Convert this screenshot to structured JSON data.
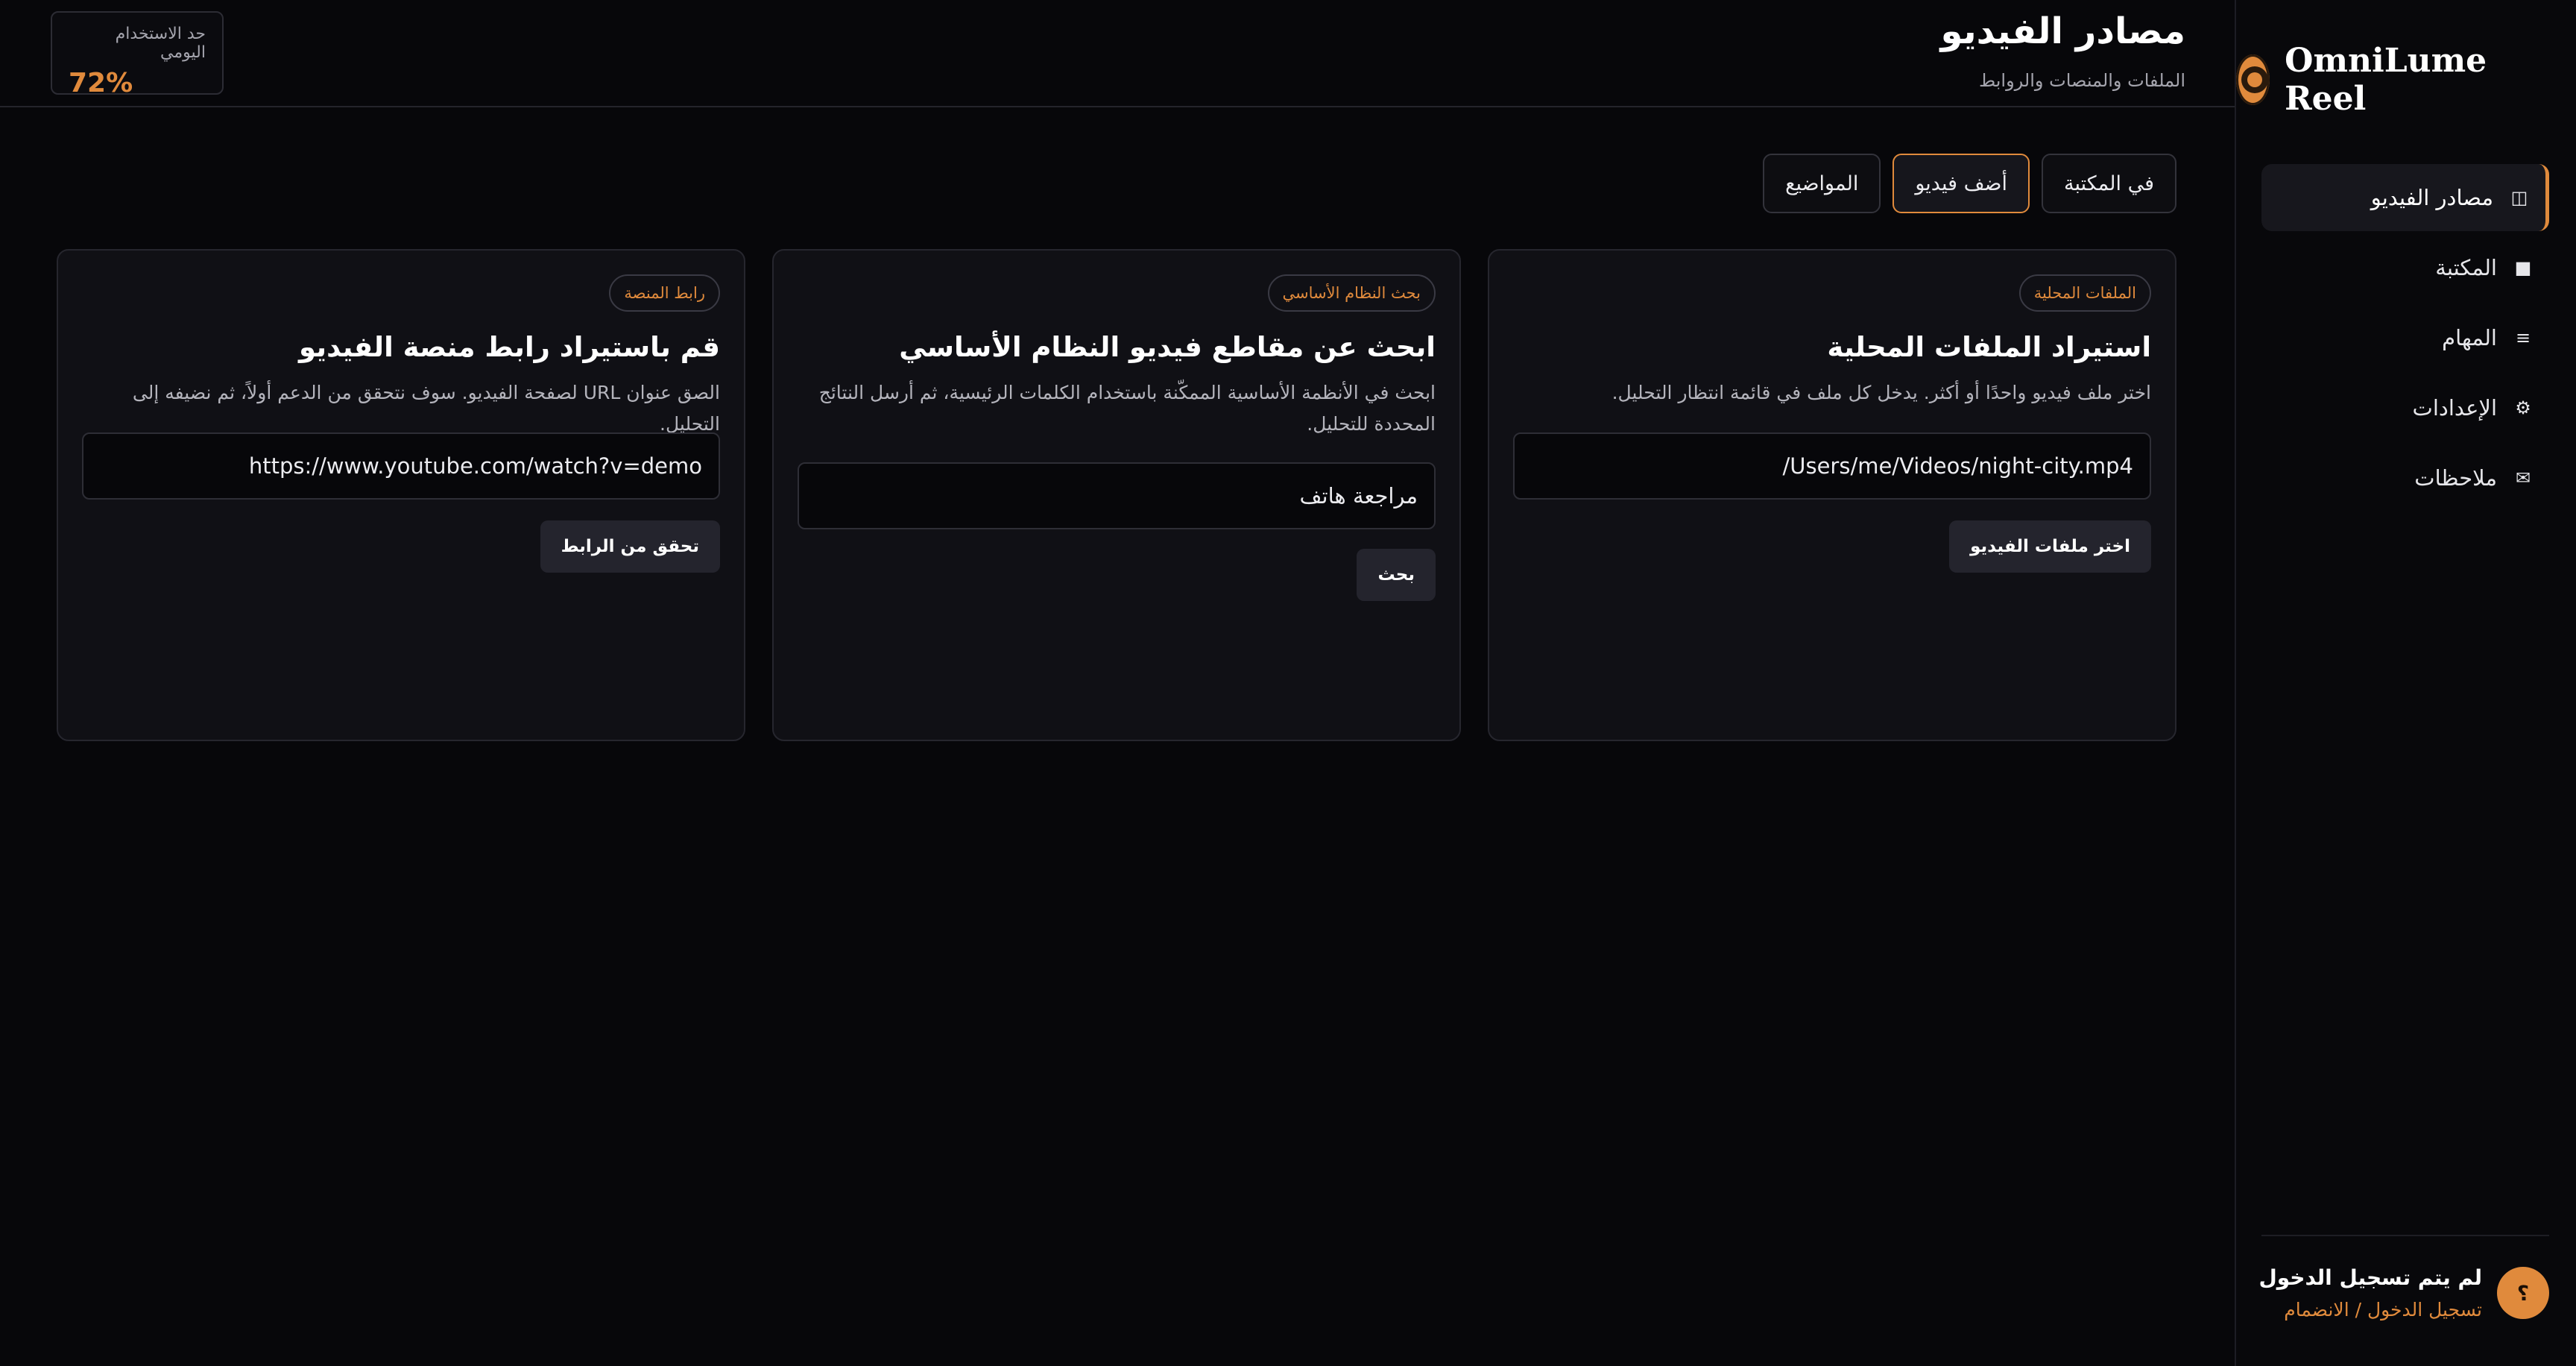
{
  "brand": {
    "name": "OmniLume Reel",
    "logo_icon": "reel-logo-icon"
  },
  "sidebar": {
    "items": [
      {
        "label": "مصادر الفيديو",
        "icon": "panel-icon",
        "glyph": "◫",
        "active": true
      },
      {
        "label": "المكتبة",
        "icon": "square-icon",
        "glyph": "■",
        "active": false
      },
      {
        "label": "المهام",
        "icon": "list-icon",
        "glyph": "≡",
        "active": false
      },
      {
        "label": "الإعدادات",
        "icon": "gear-icon",
        "glyph": "⚙",
        "active": false
      },
      {
        "label": "ملاحظات",
        "icon": "mail-icon",
        "glyph": "✉",
        "active": false
      }
    ]
  },
  "account": {
    "avatar": "؟",
    "status": "لم يتم تسجيل الدخول",
    "link": "تسجيل الدخول / الانضمام"
  },
  "header": {
    "title": "مصادر الفيديو",
    "subtitle": "الملفات والمنصات والروابط",
    "usage_label": "حد الاستخدام اليومي",
    "usage_value": "72%"
  },
  "tabs": [
    {
      "label": "في المكتبة",
      "active": false
    },
    {
      "label": "أضف فيديو",
      "active": true
    },
    {
      "label": "المواضيع",
      "active": false
    }
  ],
  "cards": {
    "local": {
      "badge": "الملفات المحلية",
      "title": "استيراد الملفات المحلية",
      "description": "اختر ملف فيديو واحدًا أو أكثر. يدخل كل ملف في قائمة انتظار التحليل.",
      "input_value": "/Users/me/Videos/night-city.mp4",
      "button": "اختر ملفات الفيديو"
    },
    "search": {
      "badge": "بحث النظام الأساسي",
      "title": "ابحث عن مقاطع فيديو النظام الأساسي",
      "description": "ابحث في الأنظمة الأساسية الممكّنة باستخدام الكلمات الرئيسية، ثم أرسل النتائج المحددة للتحليل.",
      "input_value": "مراجعة هاتف",
      "button": "بحث"
    },
    "link": {
      "badge": "رابط المنصة",
      "title": "قم باستيراد رابط منصة الفيديو",
      "description": "الصق عنوان URL لصفحة الفيديو. سوف نتحقق من الدعم أولاً، ثم نضيفه إلى التحليل.",
      "input_value": "https://www.youtube.com/watch?v=demo",
      "button": "تحقق من الرابط"
    }
  },
  "colors": {
    "accent": "#e08a3c",
    "background": "#07070a",
    "card": "#101015"
  }
}
